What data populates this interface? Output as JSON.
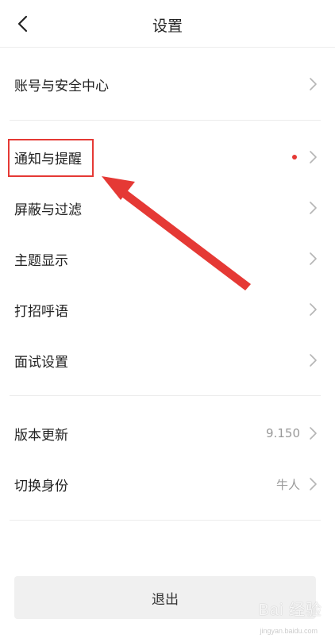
{
  "header": {
    "title": "设置"
  },
  "groups": [
    {
      "items": [
        {
          "label": "账号与安全中心",
          "value": "",
          "dot": false
        }
      ]
    },
    {
      "items": [
        {
          "label": "通知与提醒",
          "value": "",
          "dot": true
        },
        {
          "label": "屏蔽与过滤",
          "value": "",
          "dot": false
        },
        {
          "label": "主题显示",
          "value": "",
          "dot": false
        },
        {
          "label": "打招呼语",
          "value": "",
          "dot": false
        },
        {
          "label": "面试设置",
          "value": "",
          "dot": false
        }
      ]
    },
    {
      "items": [
        {
          "label": "版本更新",
          "value": "9.150",
          "dot": false
        },
        {
          "label": "切换身份",
          "value": "牛人",
          "dot": false
        }
      ]
    }
  ],
  "logout": {
    "label": "退出"
  },
  "watermark": {
    "text": "Bai 经验",
    "sub": "jingyan.baidu.com"
  },
  "colors": {
    "accent": "#e53935",
    "divider": "#ececec",
    "button_bg": "#f0f0f0"
  },
  "icons": {
    "back": "chevron-left-icon",
    "row": "chevron-right-icon"
  }
}
